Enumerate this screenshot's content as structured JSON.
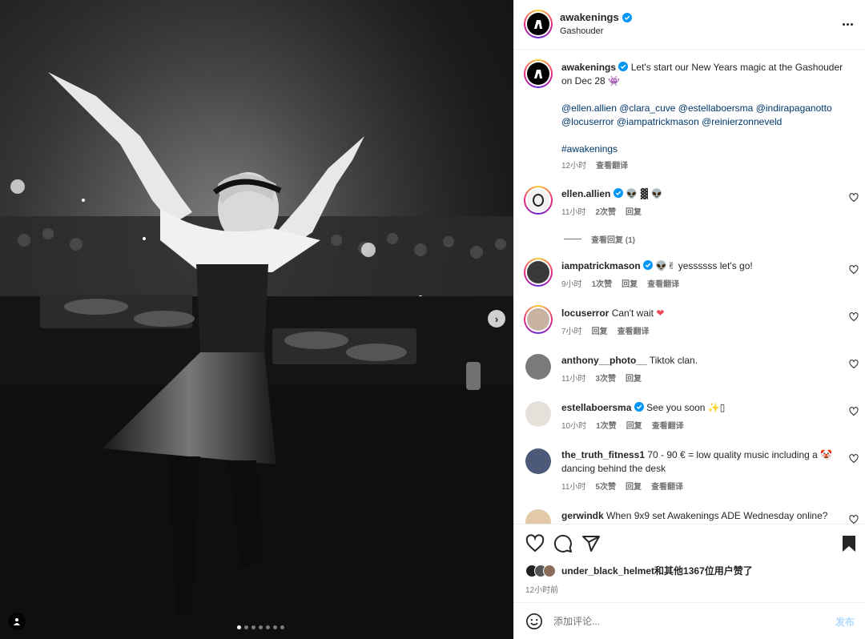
{
  "post": {
    "username": "awakenings",
    "location": "Gashouder",
    "more_icon": "more-horizontal-icon"
  },
  "caption": {
    "username": "awakenings",
    "text": "Let's start our New Years magic at the Gashouder on Dec 28",
    "emoji": "👾",
    "mentions_line1": [
      "@ellen.allien",
      "@clara_cuve",
      "@estellaboersma",
      "@indirapaganotto"
    ],
    "mentions_line2": [
      "@locuserror",
      "@iampatrickmason",
      "@reinierzonneveld"
    ],
    "hashtag": "#awakenings",
    "time": "12小时",
    "translate": "查看翻译"
  },
  "comments": [
    {
      "user": "ellen.allien",
      "verified": true,
      "text": "",
      "emoji": "👽 ▓ 👽",
      "time": "11小时",
      "likes": "2次赞",
      "reply": "回复",
      "translate": ""
    },
    {
      "user": "iampatrickmason",
      "verified": true,
      "text": "yessssss let's go!",
      "emoji": "👽✌",
      "time": "9小时",
      "likes": "1次赞",
      "reply": "回复",
      "translate": "查看翻译"
    },
    {
      "user": "locuserror",
      "verified": false,
      "text": "Can't wait",
      "emoji": "❤",
      "time": "7小时",
      "likes": "",
      "reply": "回复",
      "translate": "查看翻译"
    },
    {
      "user": "anthony__photo__",
      "verified": false,
      "text": "Tiktok clan.",
      "emoji": "",
      "time": "11小时",
      "likes": "3次赞",
      "reply": "回复",
      "translate": ""
    },
    {
      "user": "estellaboersma",
      "verified": true,
      "text": "See you soon",
      "emoji": "✨▯",
      "time": "10小时",
      "likes": "1次赞",
      "reply": "回复",
      "translate": "查看翻译"
    },
    {
      "user": "the_truth_fitness1",
      "verified": false,
      "text": "70 - 90 € = low quality music including a",
      "text2": "dancing behind the desk",
      "emoji": "🤡",
      "time": "11小时",
      "likes": "5次赞",
      "reply": "回复",
      "translate": "查看翻译"
    },
    {
      "user": "gerwindk",
      "verified": false,
      "text": "When 9x9 set Awakenings ADE Wednesday online?",
      "emoji": "",
      "time": "",
      "likes": "",
      "reply": "",
      "translate": ""
    }
  ],
  "view_replies": "查看回复 (1)",
  "likes_summary": {
    "user": "under_black_helmet",
    "rest": "和其他1367位用户赞了"
  },
  "post_time": "12小时前",
  "composer": {
    "placeholder": "添加评论...",
    "post_label": "发布"
  },
  "carousel": {
    "total": 7,
    "active": 1
  },
  "colors": {
    "link": "#00376b",
    "verified": "#0095f6",
    "muted": "#737373",
    "post_disabled": "#b3dbff"
  }
}
